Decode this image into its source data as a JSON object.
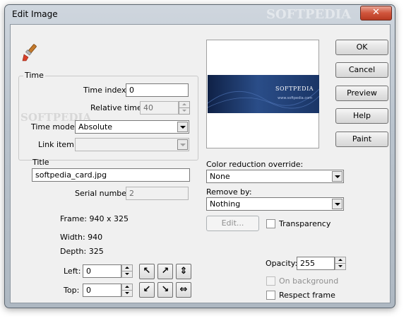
{
  "window": {
    "title": "Edit Image",
    "close_glyph": "✕"
  },
  "watermark": "SOFTPEDIA",
  "time_group": {
    "label": "Time",
    "time_index_label": "Time index:",
    "time_index_value": "0",
    "relative_time_label": "Relative time:",
    "relative_time_value": "40",
    "time_mode_label": "Time mode:",
    "time_mode_value": "Absolute",
    "link_item_label": "Link item:",
    "link_item_value": ""
  },
  "title_field": {
    "label": "Title",
    "value": "softpedia_card.jpg"
  },
  "serial": {
    "label": "Serial number:",
    "value": "2"
  },
  "info": {
    "frame": "Frame:  940 x 325",
    "width": "Width:  940",
    "depth": "Depth:  325"
  },
  "position": {
    "left_label": "Left:",
    "left_value": "0",
    "top_label": "Top:",
    "top_value": "0"
  },
  "align_icons": [
    "arrow-up-left-icon",
    "arrow-up-right-icon",
    "arrows-vertical-icon",
    "arrow-down-left-icon",
    "arrow-down-right-icon",
    "arrows-horizontal-icon"
  ],
  "preview": {
    "card_text": "SOFTPEDIA",
    "card_sub": "www.softpedia.com"
  },
  "color_reduction": {
    "label": "Color reduction override:",
    "value": "None"
  },
  "remove_by": {
    "label": "Remove by:",
    "value": "Nothing"
  },
  "edit_button": "Edit...",
  "transparency_label": "Transparency",
  "opacity": {
    "label": "Opacity:",
    "value": "255"
  },
  "on_background_label": "On background",
  "respect_frame_label": "Respect frame",
  "buttons": {
    "ok": "OK",
    "cancel": "Cancel",
    "preview": "Preview",
    "help": "Help",
    "paint": "Paint"
  }
}
